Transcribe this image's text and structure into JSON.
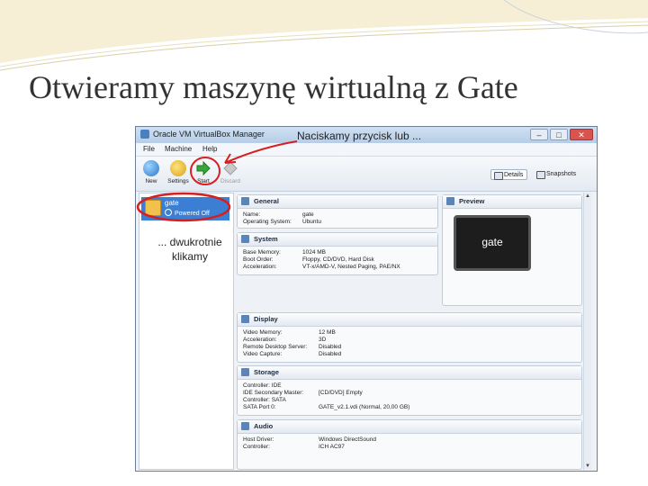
{
  "slide": {
    "title": "Otwieramy maszynę wirtualną z Gate"
  },
  "window": {
    "title": "Oracle VM VirtualBox Manager",
    "min": "–",
    "max": "□",
    "close": "✕"
  },
  "menu": [
    "File",
    "Machine",
    "Help"
  ],
  "toolbar": {
    "new": "New",
    "settings": "Settings",
    "start": "Start",
    "discard": "Discard",
    "details": "Details",
    "snapshots": "Snapshots"
  },
  "vm": {
    "name": "gate",
    "state": "Powered Off"
  },
  "annotations": {
    "click_button": "Naciskamy przycisk lub ...",
    "double_click": "... dwukrotnie klikamy"
  },
  "sections": {
    "general": {
      "title": "General",
      "rows": [
        {
          "k": "Name:",
          "v": "gate"
        },
        {
          "k": "Operating System:",
          "v": "Ubuntu"
        }
      ]
    },
    "system": {
      "title": "System",
      "rows": [
        {
          "k": "Base Memory:",
          "v": "1024 MB"
        },
        {
          "k": "Boot Order:",
          "v": "Floppy, CD/DVD, Hard Disk"
        },
        {
          "k": "Acceleration:",
          "v": "VT-x/AMD-V, Nested Paging, PAE/NX"
        }
      ]
    },
    "preview": {
      "title": "Preview",
      "screen_text": "gate"
    },
    "display": {
      "title": "Display",
      "rows": [
        {
          "k": "Video Memory:",
          "v": "12 MB"
        },
        {
          "k": "Acceleration:",
          "v": "3D"
        },
        {
          "k": "Remote Desktop Server:",
          "v": "Disabled"
        },
        {
          "k": "Video Capture:",
          "v": "Disabled"
        }
      ]
    },
    "storage": {
      "title": "Storage",
      "rows": [
        {
          "k": "Controller: IDE",
          "v": ""
        },
        {
          "k": "  IDE Secondary Master:",
          "v": "[CD/DVD] Empty"
        },
        {
          "k": "Controller: SATA",
          "v": ""
        },
        {
          "k": "  SATA Port 0:",
          "v": "GATE_v2.1.vdi (Normal, 20,00 GB)"
        }
      ]
    },
    "audio": {
      "title": "Audio",
      "rows": [
        {
          "k": "Host Driver:",
          "v": "Windows DirectSound"
        },
        {
          "k": "Controller:",
          "v": "ICH AC97"
        }
      ]
    }
  },
  "colors": {
    "selection": "#3b7fd5",
    "highlight_ring": "#d81e1e",
    "start_arrow": "#3aa63a"
  }
}
